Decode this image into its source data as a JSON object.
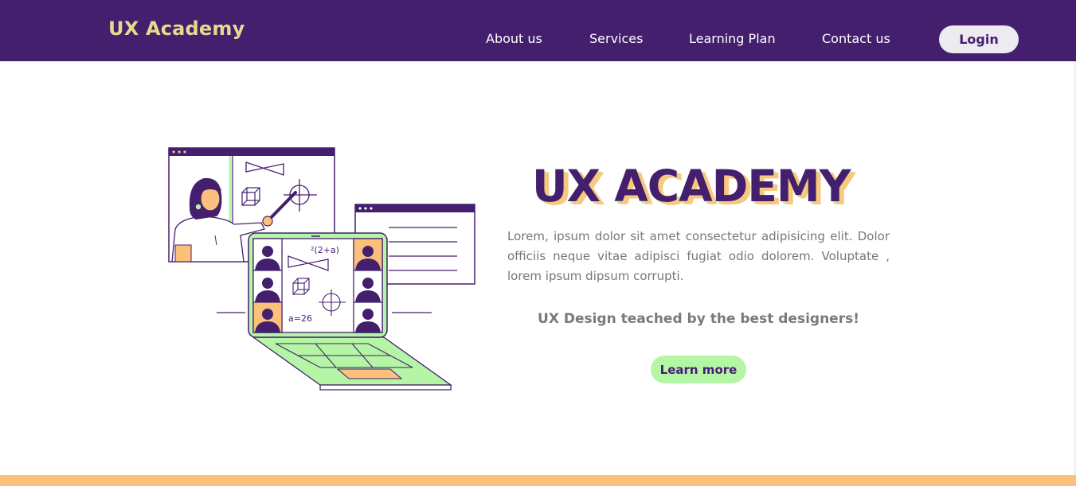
{
  "header": {
    "logo": "UX Academy",
    "nav": [
      {
        "label": "About us"
      },
      {
        "label": "Services"
      },
      {
        "label": "Learning Plan"
      },
      {
        "label": "Contact us"
      }
    ],
    "login_label": "Login"
  },
  "hero": {
    "title": "UX ACADEMY",
    "description": "Lorem, ipsum dolor sit amet consectetur adipisicing elit. Dolor officiis neque vitae adipisci fugiat odio dolorem. Voluptate , lorem ipsum dipsum corrupti.",
    "tagline": "UX Design teached by the best designers!",
    "cta_label": "Learn more",
    "illustration": {
      "board_formula_top": "²(2+a)",
      "board_formula_bottom": "a=26"
    }
  },
  "colors": {
    "brand_purple": "#441f6e",
    "logo_yellow": "#e9d88e",
    "accent_green": "#b5f5a6",
    "accent_orange": "#fbc17c",
    "text_gray": "#777777"
  }
}
